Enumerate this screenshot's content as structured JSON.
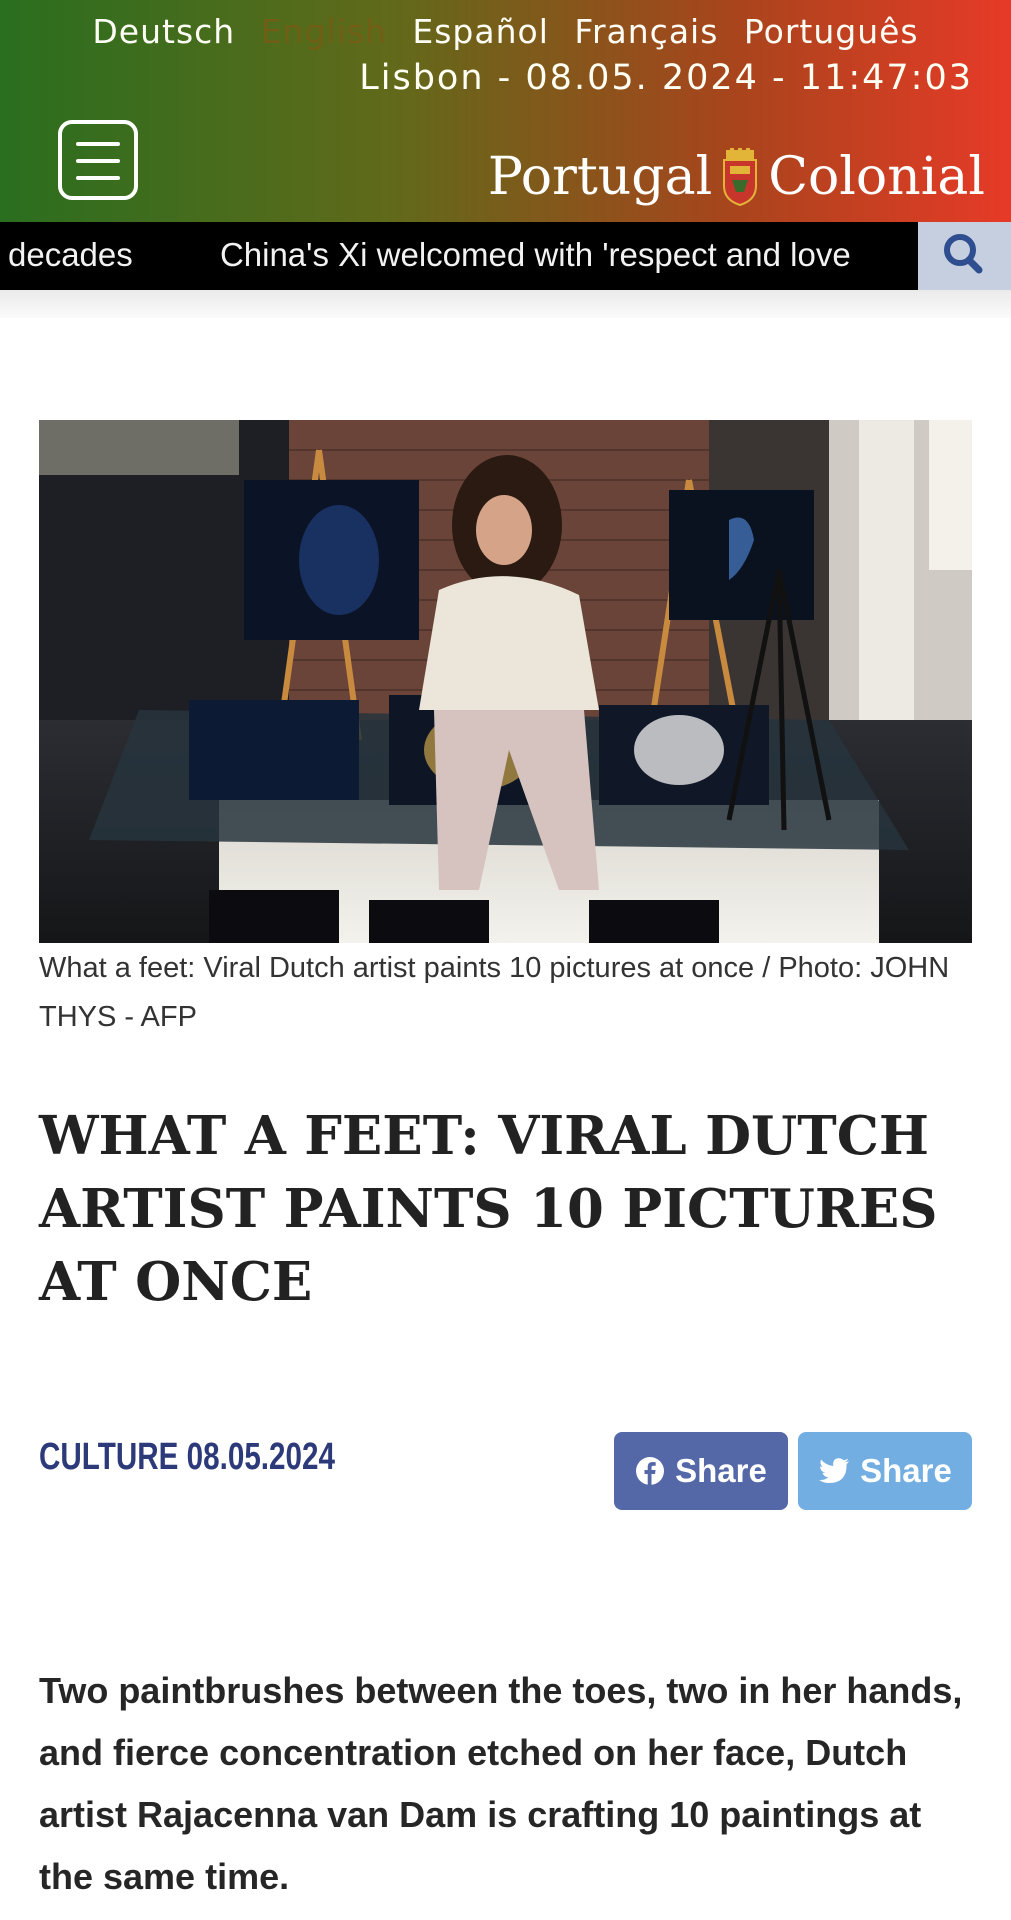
{
  "header": {
    "languages": [
      "Deutsch",
      "English",
      "Español",
      "Français",
      "Português"
    ],
    "active_language": "English",
    "datetime": "Lisbon - 08.05. 2024 - 11:47:03",
    "logo_left": "Portugal",
    "logo_right": "Colonial"
  },
  "ticker": {
    "items": [
      "decades",
      "China's Xi welcomed with 'respect and love"
    ]
  },
  "article": {
    "photo_caption": "What a feet: Viral Dutch artist paints 10 pictures at once / Photo: JOHN THYS - AFP",
    "title": "WHAT A FEET: VIRAL DUTCH ARTIST PAINTS 10 PICTURES AT ONCE",
    "category": "CULTURE",
    "date": "08.05.2024",
    "share_facebook": "Share",
    "share_twitter": "Share",
    "lead": "Two paintbrushes between the toes, two in her hands, and fierce concentration etched on her face, Dutch artist Rajacenna van Dam is crafting 10 paintings at the same time."
  },
  "colors": {
    "header_left": "#2a6e1f",
    "header_right": "#e63a27",
    "category": "#2c3a7a",
    "facebook": "#5468a8",
    "twitter": "#73aee2",
    "search_bg": "#c6cfe0"
  },
  "icons": [
    "menu-icon",
    "search-icon",
    "crest-icon",
    "facebook-icon",
    "twitter-icon"
  ]
}
